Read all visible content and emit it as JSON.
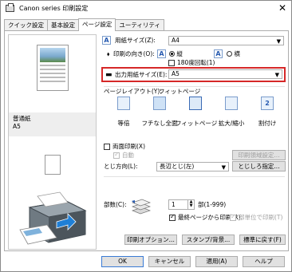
{
  "window": {
    "title": "Canon series 印刷設定",
    "close_label": "✕"
  },
  "tabs": [
    "クイック設定",
    "基本設定",
    "ページ設定",
    "ユーティリティ"
  ],
  "active_tab": "ページ設定",
  "preview": {
    "media_label": "普通紙",
    "size_label": "A5"
  },
  "page_size": {
    "label": "用紙サイズ(Z):",
    "value": "A4"
  },
  "orientation": {
    "label": "印刷の向き(O):",
    "portrait": "縦",
    "landscape": "横",
    "selected": "portrait",
    "rotate_label": "180度回転(1)"
  },
  "output_size": {
    "label": "出力用紙サイズ(E):",
    "value": "A5"
  },
  "layout": {
    "label": "ページレイアウト(Y):",
    "current": "フィットページ",
    "options": [
      "等倍",
      "フチなし全面",
      "フィットページ",
      "拡大/縮小",
      "割付け"
    ],
    "selected": "フィットページ"
  },
  "duplex": {
    "label": "両面印刷(X)",
    "checked": false,
    "auto_label": "自動",
    "auto_checked": true,
    "area_button": "印刷領域設定..."
  },
  "binding": {
    "label": "とじ方向(L):",
    "value": "長辺とじ(左)",
    "margin_button": "とじしろ指定..."
  },
  "copies": {
    "label": "部数(C):",
    "value": "1",
    "range": "部(1-999)",
    "last_page_label": "最終ページから印刷(R)",
    "last_page_checked": true,
    "collate_label": "部単位で印刷(T)",
    "collate_checked": true
  },
  "actions": {
    "print_options": "印刷オプション...",
    "stamp": "スタンプ/背景...",
    "defaults": "標準に戻す(F)"
  },
  "footer": {
    "ok": "OK",
    "cancel": "キャンセル",
    "apply": "適用(A)",
    "help": "ヘルプ"
  },
  "colors": {
    "highlight": "#d62828",
    "accent": "#2559b0",
    "tab_bg": "#f0f0f0",
    "button_bg": "#e1e1e1"
  }
}
